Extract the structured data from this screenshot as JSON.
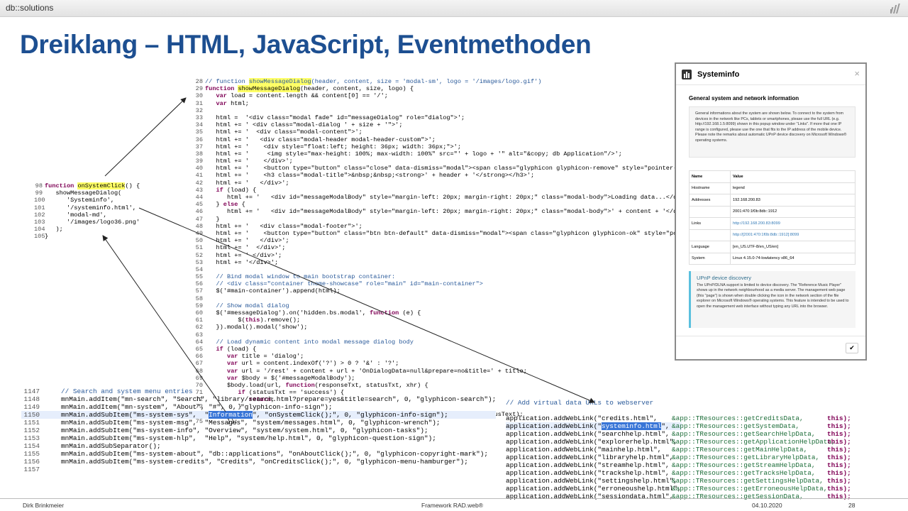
{
  "header": {
    "brand": "db::solutions",
    "logo_icon": "bars-logo-icon"
  },
  "slide": {
    "title": "Dreiklang – HTML, JavaScript, Eventmethoden"
  },
  "footer": {
    "author": "Dirk Brinkmeier",
    "center": "Framework RAD.web®",
    "date": "04.10.2020",
    "page": "28"
  },
  "code_js": {
    "lines": [
      {
        "n": "28",
        "t": "// function showMessageDialog(header, content, size = 'modal-sm', logo = '/images/logo.gif')"
      },
      {
        "n": "29",
        "t": "function showMessageDialog(header, content, size, logo) {"
      },
      {
        "n": "30",
        "t": "   var load = content.length && content[0] == '/';"
      },
      {
        "n": "31",
        "t": "   var html;"
      },
      {
        "n": "32",
        "t": ""
      },
      {
        "n": "33",
        "t": "   html =  '<div class=\"modal fade\" id=\"messageDialog\" role=\"dialog\">';"
      },
      {
        "n": "34",
        "t": "   html += ' <div class=\"modal-dialog ' + size + '\">';"
      },
      {
        "n": "35",
        "t": "   html += '  <div class=\"modal-content\">';"
      },
      {
        "n": "36",
        "t": "   html += '   <div class=\"modal-header modal-header-custom\">';"
      },
      {
        "n": "37",
        "t": "   html += '    <div style=\"float:left; height: 36px; width: 36px;\">';"
      },
      {
        "n": "38",
        "t": "   html += '     <img style=\"max-height: 100%; max-width: 100%\" src=\"' + logo + '\" alt=\"&copy; db Application\"/>';"
      },
      {
        "n": "39",
        "t": "   html += '    </div>';"
      },
      {
        "n": "40",
        "t": "   html += '    <button type=\"button\" class=\"close\" data-dismiss=\"modal\"><span class=\"glyphicon glyphicon-remove\" style=\"pointer-events:"
      },
      {
        "n": "41",
        "t": "   html += '    <h3 class=\"modal-title\">&nbsp;&nbsp;<strong>' + header + '</strong></h3>';"
      },
      {
        "n": "42",
        "t": "   html += '   </div>';"
      },
      {
        "n": "43",
        "t": "   if (load) {"
      },
      {
        "n": "44",
        "t": "      html += '   <div id=\"messageModalBody\" style=\"margin-left: 20px; margin-right: 20px;\" class=\"modal-body\">Loading data...</div>';"
      },
      {
        "n": "45",
        "t": "   } else {"
      },
      {
        "n": "46",
        "t": "      html += '   <div id=\"messageModalBody\" style=\"margin-left: 20px; margin-right: 20px;\" class=\"modal-body\">' + content + '</div>';"
      },
      {
        "n": "47",
        "t": "   }"
      },
      {
        "n": "48",
        "t": "   html += '   <div class=\"modal-footer\">';"
      },
      {
        "n": "49",
        "t": "   html += '    <button type=\"button\" class=\"btn btn-default\" data-dismiss=\"modal\"><span class=\"glyphicon glyphicon-ok\" style=\"pointer-e"
      },
      {
        "n": "50",
        "t": "   html += '   </div>';"
      },
      {
        "n": "51",
        "t": "   html += '  </div>';"
      },
      {
        "n": "52",
        "t": "   html += ' </div>';"
      },
      {
        "n": "53",
        "t": "   html += '</div>';"
      },
      {
        "n": "54",
        "t": ""
      },
      {
        "n": "55",
        "t": "   // Bind modal window to main bootstrap container:"
      },
      {
        "n": "56",
        "t": "   // <div class=\"container theme-showcase\" role=\"main\" id=\"main-container\">"
      },
      {
        "n": "57",
        "t": "   $('#main-container').append(html);"
      },
      {
        "n": "58",
        "t": ""
      },
      {
        "n": "59",
        "t": "   // Show modal dialog"
      },
      {
        "n": "60",
        "t": "   $('#messageDialog').on('hidden.bs.modal', function (e) {"
      },
      {
        "n": "61",
        "t": "         $(this).remove();"
      },
      {
        "n": "62",
        "t": "   }).modal().modal('show');"
      },
      {
        "n": "63",
        "t": ""
      },
      {
        "n": "64",
        "t": "   // Load dynamic content into modal message dialog body"
      },
      {
        "n": "65",
        "t": "   if (load) {"
      },
      {
        "n": "66",
        "t": "      var title = 'dialog';"
      },
      {
        "n": "67",
        "t": "      var url = content.indexOf('?') > 0 ? '&' : '?';"
      },
      {
        "n": "68",
        "t": "      var url = '/rest' + content + url + 'OnDialogData=null&prepare=no&title=' + title;"
      },
      {
        "n": "69",
        "t": "      var $body = $('#messageModalBody');"
      },
      {
        "n": "70",
        "t": "      $body.load(url, function(responseTxt, statusTxt, xhr) {"
      },
      {
        "n": "71",
        "t": "         if (statusTxt == 'success') {"
      },
      {
        "n": "72",
        "t": "            return;"
      },
      {
        "n": "73",
        "t": "         }"
      },
      {
        "n": "74",
        "t": "         $body.html('[' + title + '] Failure: ' + xhr.status + ' - ' + xhr.statusText);"
      },
      {
        "n": "75",
        "t": "      });"
      }
    ]
  },
  "code_click": {
    "lines": [
      {
        "n": "98",
        "t": "function onSystemClick() {"
      },
      {
        "n": "99",
        "t": "   showMessageDialog("
      },
      {
        "n": "100",
        "t": "      'Systeminfo',"
      },
      {
        "n": "101",
        "t": "      '/systeminfo.html',"
      },
      {
        "n": "102",
        "t": "      'modal-md',"
      },
      {
        "n": "103",
        "t": "      '/images/logo36.png'"
      },
      {
        "n": "104",
        "t": "   );"
      },
      {
        "n": "105",
        "t": "}"
      }
    ]
  },
  "code_menu": {
    "lines": [
      {
        "n": "1147",
        "t": "// Search and system menu entries"
      },
      {
        "n": "1148",
        "t": "mnMain.addItem(\"mn-search\", \"Search\", \"library/search.html?prepare=yes&title=search\", 0, \"glyphicon-search\");"
      },
      {
        "n": "1149",
        "t": "mnMain.addItem(\"mn-system\", \"About\", \"#\", 0, \"glyphicon-info-sign\");"
      },
      {
        "n": "1150",
        "t": "mnMain.addSubItem(\"ms-system-sys\",  \"Information\", \"onSystemClick();\", 0, \"glyphicon-info-sign\");"
      },
      {
        "n": "1151",
        "t": "mnMain.addSubItem(\"ms-system-msg\",  \"Messages\", \"system/messages.html\", 0, \"glyphicon-wrench\");"
      },
      {
        "n": "1152",
        "t": "mnMain.addSubItem(\"ms-system-info\", \"Overview\", \"system/system.html\", 0, \"glyphicon-tasks\");"
      },
      {
        "n": "1153",
        "t": "mnMain.addSubItem(\"ms-system-hlp\",  \"Help\", \"system/help.html\", 0, \"glyphicon-question-sign\");"
      },
      {
        "n": "1154",
        "t": "mnMain.addSubSeparator();"
      },
      {
        "n": "1155",
        "t": "mnMain.addSubItem(\"ms-system-about\", \"db::applications\", \"onAboutClick();\", 0, \"glyphicon-copyright-mark\");"
      },
      {
        "n": "1156",
        "t": "mnMain.addSubItem(\"ms-system-credits\", \"Credits\", \"onCreditsClick();\", 0, \"glyphicon-menu-hamburger\");"
      },
      {
        "n": "1157",
        "t": ""
      }
    ]
  },
  "code_weblinks": {
    "comment": "// Add virtual data URLs to webserver",
    "rows": [
      {
        "a": "application.addWebLink(\"credits.html\",",
        "b": "&app::TResources::getCreditsData,",
        "c": "this);"
      },
      {
        "a": "application.addWebLink(\"systeminfo.html\",",
        "b": "&app::TResources::getSystemData,",
        "c": "this);"
      },
      {
        "a": "application.addWebLink(\"searchhelp.html\",",
        "b": "&app::TResources::getSearchHelpData,",
        "c": "this);"
      },
      {
        "a": "application.addWebLink(\"explorerhelp.html\",",
        "b": "&app::TResources::getApplicationHelpData,",
        "c": "this);"
      },
      {
        "a": "application.addWebLink(\"mainhelp.html\",",
        "b": "&app::TResources::getMainHelpData,",
        "c": "this);"
      },
      {
        "a": "application.addWebLink(\"libraryhelp.html\",",
        "b": "&app::TResources::getLibraryHelpData,",
        "c": "this);"
      },
      {
        "a": "application.addWebLink(\"streamhelp.html\",",
        "b": "&app::TResources::getStreamHelpData,",
        "c": "this);"
      },
      {
        "a": "application.addWebLink(\"trackshelp.html\",",
        "b": "&app::TResources::getTracksHelpData,",
        "c": "this);"
      },
      {
        "a": "application.addWebLink(\"settingshelp.html\",",
        "b": "&app::TResources::getSettingsHelpData,",
        "c": "this);"
      },
      {
        "a": "application.addWebLink(\"erroneoushelp.html\",",
        "b": "&app::TResources::getErroneousHelpData,",
        "c": "this);"
      },
      {
        "a": "application.addWebLink(\"sessiondata.html\",",
        "b": "&app::TResources::getSessionData,",
        "c": "this);"
      }
    ]
  },
  "dialog": {
    "title": "Systeminfo",
    "close": "×",
    "section": "General system and network information",
    "intro": "General informations about the system are shown below. To connect to the system from devices in the network like PCs, tablets or smartphones, please use the full URL (e.g. http://192.168.1.5:8099) shown in this popup window under \"Links\". If more that one IP range is configured, please use the one that fits to the IP address of the mobile device. Please note the remarks about automatic UPnP device discovery on Microsoft Windows® operating systems.",
    "table_head": {
      "name": "Name",
      "value": "Value"
    },
    "rows": [
      {
        "name": "Hostname",
        "value": "legend",
        "link": false
      },
      {
        "name": "Addresses",
        "value": "192.168.200.83",
        "link": false
      },
      {
        "name": "",
        "value": "2001:470:1f0b:8db::1912",
        "link": false
      },
      {
        "name": "Links",
        "value": "http://192.168.200.83:8099",
        "link": true
      },
      {
        "name": "",
        "value": "http://[2001:470:1f0b:8db::1912]:8099",
        "link": true
      },
      {
        "name": "Language",
        "value": "[en_US.UTF-8/en_US/en]",
        "link": false
      },
      {
        "name": "System",
        "value": "Linux 4.15.0-74-lowlatency x86_64",
        "link": false
      }
    ],
    "callout_title": "UPnP device discovery",
    "callout_text": "The UPnP/DLNA support is limited to device discovery. The \"Reference Music Player\" shows up in the network neighbourhood as a media server. The management web page (this \"page\") is shown when double clicking the icon in the network section of the file explorer on Microsoft Windows® operating systems. This feature is intended to be used to open the management web interface without typing any URL into the browser.",
    "ok": "✔"
  }
}
